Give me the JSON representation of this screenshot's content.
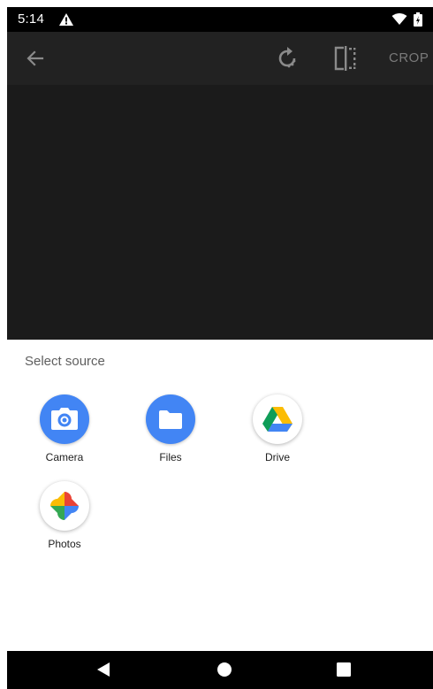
{
  "status_bar": {
    "time": "5:14",
    "icons": [
      "warning-icon",
      "wifi-icon",
      "battery-icon"
    ]
  },
  "toolbar": {
    "back_icon": "back-arrow-icon",
    "rotate_icon": "rotate-icon",
    "flip_icon": "flip-icon",
    "crop_label": "CROP"
  },
  "sheet": {
    "title": "Select source",
    "apps": [
      {
        "label": "Camera",
        "icon": "camera-icon"
      },
      {
        "label": "Files",
        "icon": "folder-icon"
      },
      {
        "label": "Drive",
        "icon": "drive-icon"
      },
      {
        "label": "Photos",
        "icon": "photos-pinwheel-icon"
      }
    ]
  },
  "nav_bar": {
    "icons": [
      "nav-back-icon",
      "nav-home-icon",
      "nav-recents-icon"
    ]
  },
  "colors": {
    "toolbar_bg": "#222222",
    "preview_bg": "#1b1b1b",
    "accent_blue": "#4285f4"
  }
}
